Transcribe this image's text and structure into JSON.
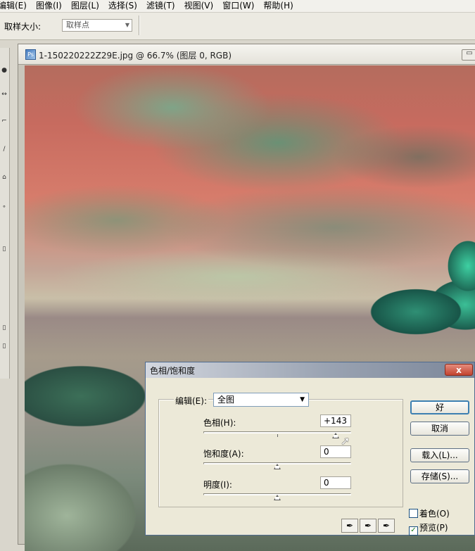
{
  "menubar": {
    "items": [
      "编辑(E)",
      "图像(I)",
      "图层(L)",
      "选择(S)",
      "滤镜(T)",
      "视图(V)",
      "窗口(W)",
      "帮助(H)"
    ]
  },
  "options_bar": {
    "sample_size_label": "取样大小:",
    "sample_size_value": "取样点"
  },
  "document": {
    "title": "1-150220222Z29E.jpg @ 66.7% (图层 0, RGB)",
    "minimize_glyph": "▭"
  },
  "dialog": {
    "title": "色相/饱和度",
    "close_glyph": "x",
    "edit_label": "编辑(E):",
    "edit_value": "全图",
    "hue": {
      "label": "色相(H):",
      "value": "+143",
      "fraction": 0.897
    },
    "saturation": {
      "label": "饱和度(A):",
      "value": "0",
      "fraction": 0.5
    },
    "lightness": {
      "label": "明度(I):",
      "value": "0",
      "fraction": 0.5
    },
    "buttons": {
      "ok": "好",
      "cancel": "取消",
      "load": "载入(L)...",
      "save": "存储(S)..."
    },
    "colorize": {
      "label": "着色(O)",
      "checked": false
    },
    "preview": {
      "label": "预览(P)",
      "checked": true
    }
  }
}
